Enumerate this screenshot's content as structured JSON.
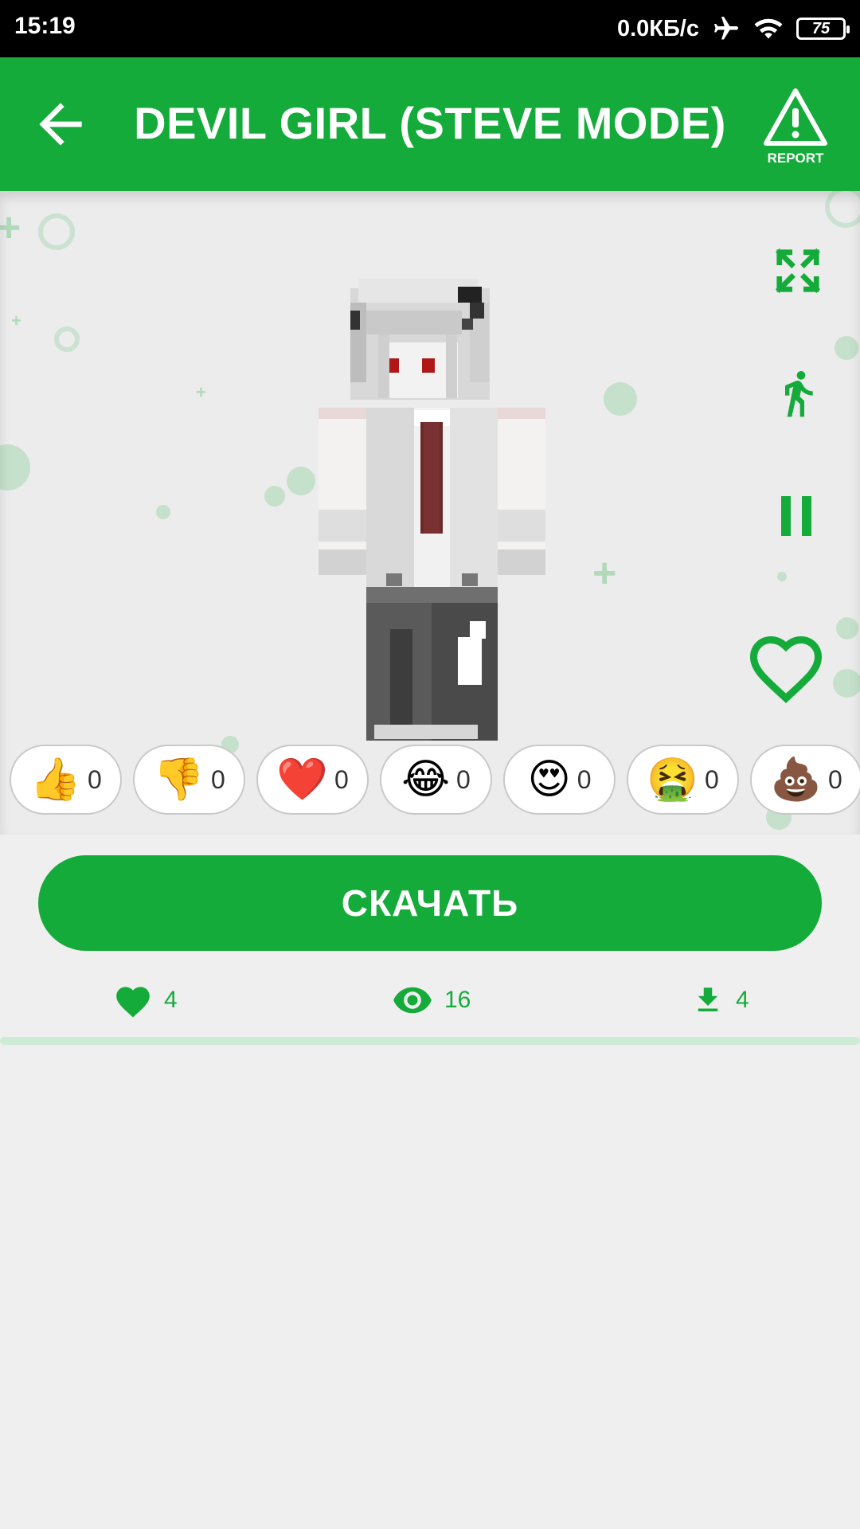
{
  "status": {
    "time": "15:19",
    "network_speed": "0.0КБ/с",
    "battery": "75"
  },
  "header": {
    "title": "DEVIL GIRL (STEVE MODE)",
    "report_label": "REPORT"
  },
  "preview": {
    "controls": [
      "fullscreen-icon",
      "run-icon",
      "pause-icon",
      "heart-outline-icon"
    ]
  },
  "reactions": [
    {
      "emoji": "👍",
      "count": "0",
      "name": "thumbs-up"
    },
    {
      "emoji": "👎",
      "count": "0",
      "name": "thumbs-down"
    },
    {
      "emoji": "❤️",
      "count": "0",
      "name": "heart"
    },
    {
      "emoji": "😂",
      "count": "0",
      "name": "laughing"
    },
    {
      "emoji": "😍",
      "count": "0",
      "name": "heart-eyes"
    },
    {
      "emoji": "🤮",
      "count": "0",
      "name": "vomiting"
    },
    {
      "emoji": "💩",
      "count": "0",
      "name": "poop"
    }
  ],
  "download": {
    "label": "СКАЧАТЬ"
  },
  "stats": {
    "likes": "4",
    "views": "16",
    "downloads": "4"
  },
  "colors": {
    "accent": "#14ab3a",
    "background": "#efefef"
  }
}
